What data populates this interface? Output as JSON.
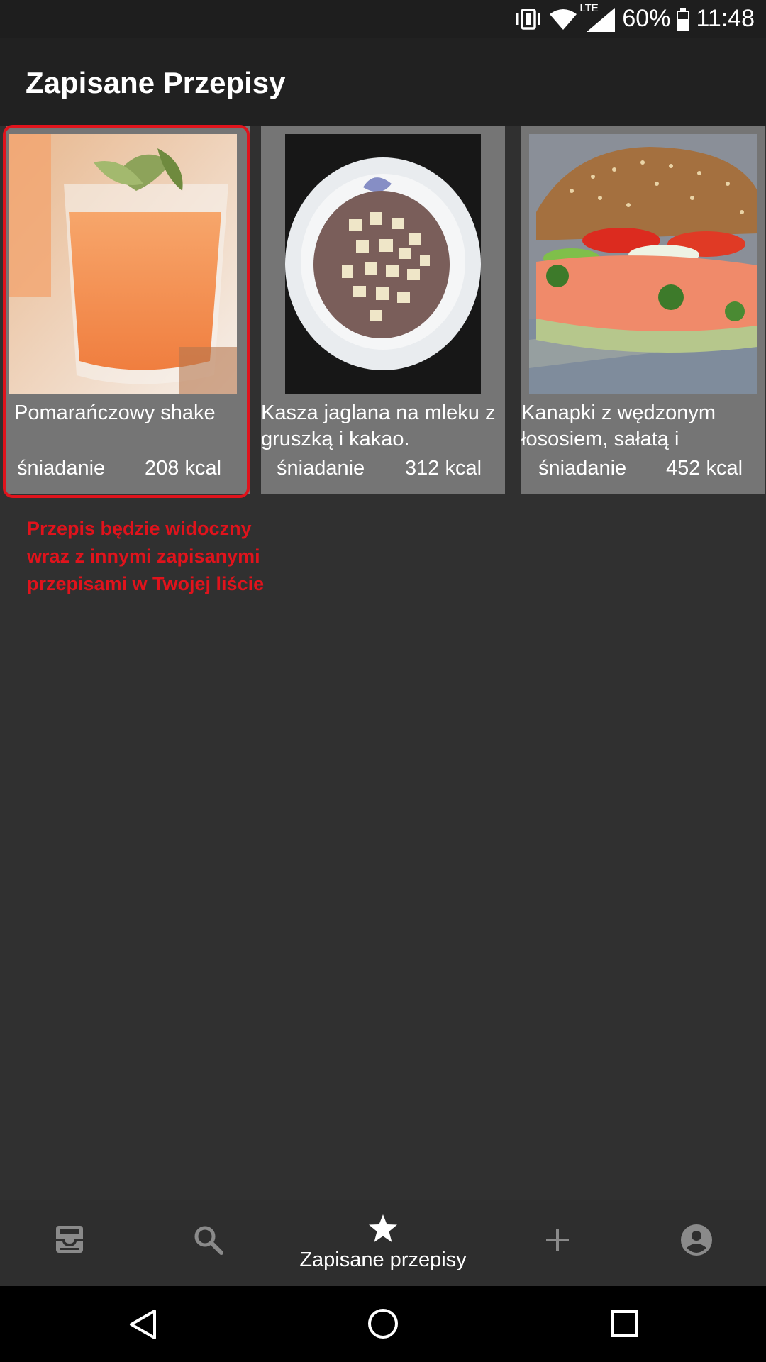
{
  "status_bar": {
    "network": "LTE",
    "battery": "60%",
    "time": "11:48",
    "icons": [
      "vibrate-icon",
      "wifi-icon",
      "cell-signal-icon",
      "battery-icon"
    ]
  },
  "app_bar": {
    "title": "Zapisane Przepisy"
  },
  "recipes": [
    {
      "title": "Pomarańczowy shake",
      "category": "śniadanie",
      "kcal": "208 kcal",
      "image": "orange-shake-photo"
    },
    {
      "title": "Kasza jaglana na mleku z gruszką i kakao.",
      "category": "śniadanie",
      "kcal": "312 kcal",
      "image": "millet-porridge-photo"
    },
    {
      "title": "Kanapki z wędzonym łososiem, sałatą i",
      "category": "śniadanie",
      "kcal": "452 kcal",
      "image": "salmon-sandwich-photo"
    }
  ],
  "annotation": "Przepis będzie widoczny wraz z innymi zapisanymi przepisami w Twojej liście",
  "bottom_nav": {
    "items": [
      {
        "icon": "inbox-icon",
        "label": ""
      },
      {
        "icon": "search-icon",
        "label": ""
      },
      {
        "icon": "star-icon",
        "label": "Zapisane przepisy",
        "active": true
      },
      {
        "icon": "plus-icon",
        "label": ""
      },
      {
        "icon": "account-icon",
        "label": ""
      }
    ]
  },
  "system_nav": {
    "icons": [
      "back-icon",
      "home-icon",
      "recents-icon"
    ]
  },
  "colors": {
    "accent_red": "#e0131c",
    "card_bg": "#757575",
    "page_bg": "#303030"
  }
}
